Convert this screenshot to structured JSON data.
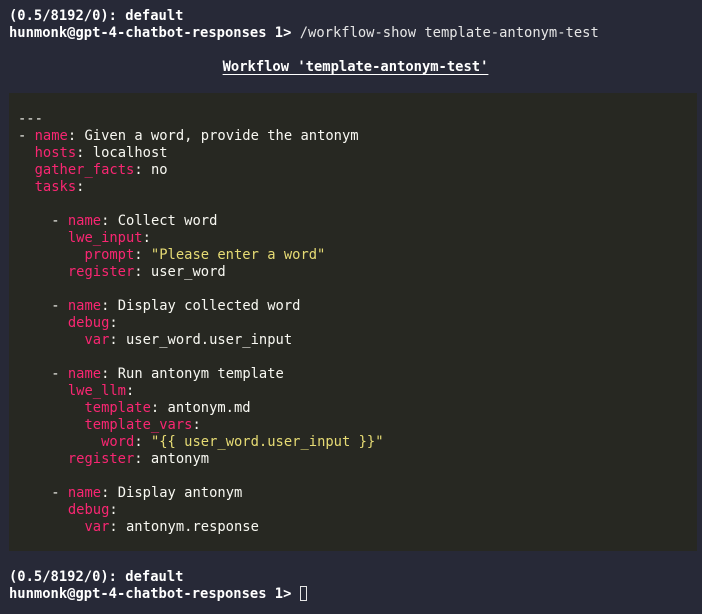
{
  "prompt_top": {
    "status": "(0.5/8192/0): default",
    "prompt": "hunmonk@gpt-4-chatbot-responses 1> ",
    "command": "/workflow-show template-antonym-test"
  },
  "header": {
    "title": "Workflow 'template-antonym-test'"
  },
  "code": {
    "lines": [
      {
        "indent": "",
        "parts": [
          {
            "t": "p",
            "v": "---"
          }
        ]
      },
      {
        "indent": "",
        "parts": [
          {
            "t": "p",
            "v": "- "
          },
          {
            "t": "k",
            "v": "name"
          },
          {
            "t": "p",
            "v": ": "
          },
          {
            "t": "v",
            "v": "Given a word, provide the antonym"
          }
        ]
      },
      {
        "indent": "  ",
        "parts": [
          {
            "t": "k",
            "v": "hosts"
          },
          {
            "t": "p",
            "v": ": "
          },
          {
            "t": "v",
            "v": "localhost"
          }
        ]
      },
      {
        "indent": "  ",
        "parts": [
          {
            "t": "k",
            "v": "gather_facts"
          },
          {
            "t": "p",
            "v": ": "
          },
          {
            "t": "v",
            "v": "no"
          }
        ]
      },
      {
        "indent": "  ",
        "parts": [
          {
            "t": "k",
            "v": "tasks"
          },
          {
            "t": "p",
            "v": ":"
          }
        ]
      },
      {
        "indent": "",
        "parts": []
      },
      {
        "indent": "    ",
        "parts": [
          {
            "t": "p",
            "v": "- "
          },
          {
            "t": "k",
            "v": "name"
          },
          {
            "t": "p",
            "v": ": "
          },
          {
            "t": "v",
            "v": "Collect word"
          }
        ]
      },
      {
        "indent": "      ",
        "parts": [
          {
            "t": "k",
            "v": "lwe_input"
          },
          {
            "t": "p",
            "v": ":"
          }
        ]
      },
      {
        "indent": "        ",
        "parts": [
          {
            "t": "k",
            "v": "prompt"
          },
          {
            "t": "p",
            "v": ": "
          },
          {
            "t": "s",
            "v": "\"Please enter a word\""
          }
        ]
      },
      {
        "indent": "      ",
        "parts": [
          {
            "t": "k",
            "v": "register"
          },
          {
            "t": "p",
            "v": ": "
          },
          {
            "t": "v",
            "v": "user_word"
          }
        ]
      },
      {
        "indent": "",
        "parts": []
      },
      {
        "indent": "    ",
        "parts": [
          {
            "t": "p",
            "v": "- "
          },
          {
            "t": "k",
            "v": "name"
          },
          {
            "t": "p",
            "v": ": "
          },
          {
            "t": "v",
            "v": "Display collected word"
          }
        ]
      },
      {
        "indent": "      ",
        "parts": [
          {
            "t": "k",
            "v": "debug"
          },
          {
            "t": "p",
            "v": ":"
          }
        ]
      },
      {
        "indent": "        ",
        "parts": [
          {
            "t": "k",
            "v": "var"
          },
          {
            "t": "p",
            "v": ": "
          },
          {
            "t": "v",
            "v": "user_word.user_input"
          }
        ]
      },
      {
        "indent": "",
        "parts": []
      },
      {
        "indent": "    ",
        "parts": [
          {
            "t": "p",
            "v": "- "
          },
          {
            "t": "k",
            "v": "name"
          },
          {
            "t": "p",
            "v": ": "
          },
          {
            "t": "v",
            "v": "Run antonym template"
          }
        ]
      },
      {
        "indent": "      ",
        "parts": [
          {
            "t": "k",
            "v": "lwe_llm"
          },
          {
            "t": "p",
            "v": ":"
          }
        ]
      },
      {
        "indent": "        ",
        "parts": [
          {
            "t": "k",
            "v": "template"
          },
          {
            "t": "p",
            "v": ": "
          },
          {
            "t": "v",
            "v": "antonym.md"
          }
        ]
      },
      {
        "indent": "        ",
        "parts": [
          {
            "t": "k",
            "v": "template_vars"
          },
          {
            "t": "p",
            "v": ":"
          }
        ]
      },
      {
        "indent": "          ",
        "parts": [
          {
            "t": "k",
            "v": "word"
          },
          {
            "t": "p",
            "v": ": "
          },
          {
            "t": "s",
            "v": "\"{{ user_word.user_input }}\""
          }
        ]
      },
      {
        "indent": "      ",
        "parts": [
          {
            "t": "k",
            "v": "register"
          },
          {
            "t": "p",
            "v": ": "
          },
          {
            "t": "v",
            "v": "antonym"
          }
        ]
      },
      {
        "indent": "",
        "parts": []
      },
      {
        "indent": "    ",
        "parts": [
          {
            "t": "p",
            "v": "- "
          },
          {
            "t": "k",
            "v": "name"
          },
          {
            "t": "p",
            "v": ": "
          },
          {
            "t": "v",
            "v": "Display antonym"
          }
        ]
      },
      {
        "indent": "      ",
        "parts": [
          {
            "t": "k",
            "v": "debug"
          },
          {
            "t": "p",
            "v": ":"
          }
        ]
      },
      {
        "indent": "        ",
        "parts": [
          {
            "t": "k",
            "v": "var"
          },
          {
            "t": "p",
            "v": ": "
          },
          {
            "t": "v",
            "v": "antonym.response"
          }
        ]
      }
    ]
  },
  "prompt_bottom": {
    "status": "(0.5/8192/0): default",
    "prompt": "hunmonk@gpt-4-chatbot-responses 1> ",
    "input_value": ""
  },
  "colors": {
    "terminal_bg": "#272937",
    "code_bg": "#272822",
    "key": "#f92672",
    "string": "#e6db74",
    "text": "#f8f8f2"
  }
}
